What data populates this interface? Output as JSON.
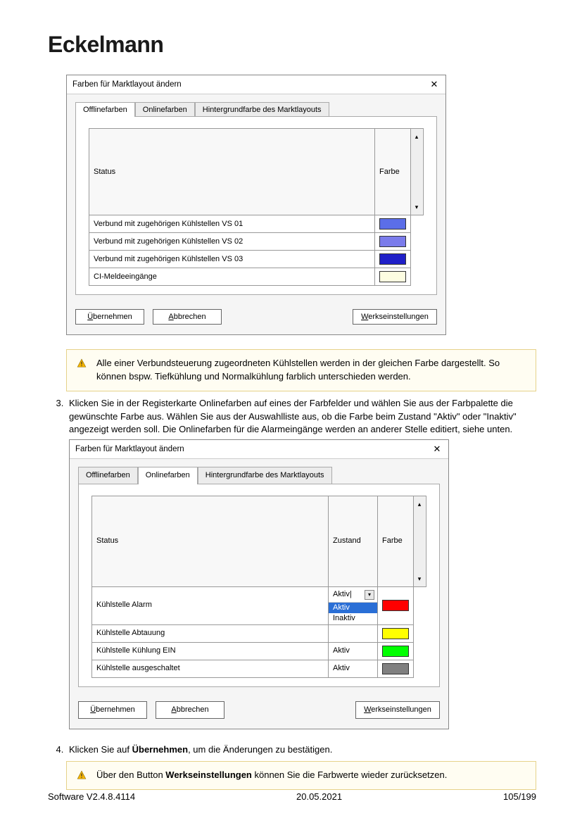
{
  "brand": "Eckelmann",
  "dialog1": {
    "title": "Farben für Marktlayout ändern",
    "tabs": {
      "offline": "Offlinefarben",
      "online": "Onlinefarben",
      "bg": "Hintergrundfarbe des Marktlayouts"
    },
    "headers": {
      "status": "Status",
      "farbe": "Farbe"
    },
    "rows": [
      {
        "status": "Verbund mit zugehörigen Kühlstellen VS 01",
        "color": "#5b6ee8"
      },
      {
        "status": "Verbund mit zugehörigen Kühlstellen VS 02",
        "color": "#7a7beb"
      },
      {
        "status": "Verbund mit zugehörigen Kühlstellen VS 03",
        "color": "#2020c8"
      },
      {
        "status": "CI-Meldeeingänge",
        "color": "#fdfde1"
      }
    ],
    "buttons": {
      "apply": {
        "pre": "Ü",
        "rest": "bernehmen"
      },
      "cancel": {
        "pre": "A",
        "rest": "bbrechen"
      },
      "defaults": {
        "pre": "W",
        "rest": "erkseinstellungen"
      }
    }
  },
  "note1": "Alle einer Verbundsteuerung zugeordneten Kühlstellen werden in der gleichen Farbe dargestellt. So können bspw. Tiefkühlung und Normalkühlung farblich unterschieden werden.",
  "step3": "Klicken Sie in der Registerkarte Onlinefarben auf eines der Farbfelder und wählen Sie aus der Farbpalette die gewünschte Farbe aus. Wählen Sie aus der Auswahlliste aus, ob die Farbe beim Zustand \"Aktiv\" oder \"Inaktiv\" angezeigt werden soll. Die Onlinefarben für die Alarmeingänge werden an anderer Stelle editiert, siehe unten.",
  "dialog2": {
    "title": "Farben für Marktlayout ändern",
    "tabs": {
      "offline": "Offlinefarben",
      "online": "Onlinefarben",
      "bg": "Hintergrundfarbe des Marktlayouts"
    },
    "headers": {
      "status": "Status",
      "zustand": "Zustand",
      "farbe": "Farbe"
    },
    "rows": [
      {
        "status": "Kühlstelle Alarm",
        "zustand": "Aktiv",
        "color": "#ff0000",
        "dropdown": {
          "options": [
            "Aktiv",
            "Inaktiv"
          ],
          "selectedIndex": 0
        }
      },
      {
        "status": "Kühlstelle Abtauung",
        "zustand": "",
        "color": "#ffff00"
      },
      {
        "status": "Kühlstelle Kühlung EIN",
        "zustand": "Aktiv",
        "color": "#00ff00"
      },
      {
        "status": "Kühlstelle ausgeschaltet",
        "zustand": "Aktiv",
        "color": "#808080"
      }
    ],
    "buttons": {
      "apply": {
        "pre": "Ü",
        "rest": "bernehmen"
      },
      "cancel": {
        "pre": "A",
        "rest": "bbrechen"
      },
      "defaults": {
        "pre": "W",
        "rest": "erkseinstellungen"
      }
    }
  },
  "step4": {
    "pre": "Klicken Sie auf ",
    "bold": "Übernehmen",
    "post": ", um die Änderungen zu bestätigen."
  },
  "note2": {
    "pre": "Über den Button ",
    "bold": "Werkseinstellungen",
    "post": " können Sie die Farbwerte wieder zurücksetzen."
  },
  "footer": {
    "left": "Software V2.4.8.4114",
    "center": "20.05.2021",
    "right": "105/199"
  }
}
